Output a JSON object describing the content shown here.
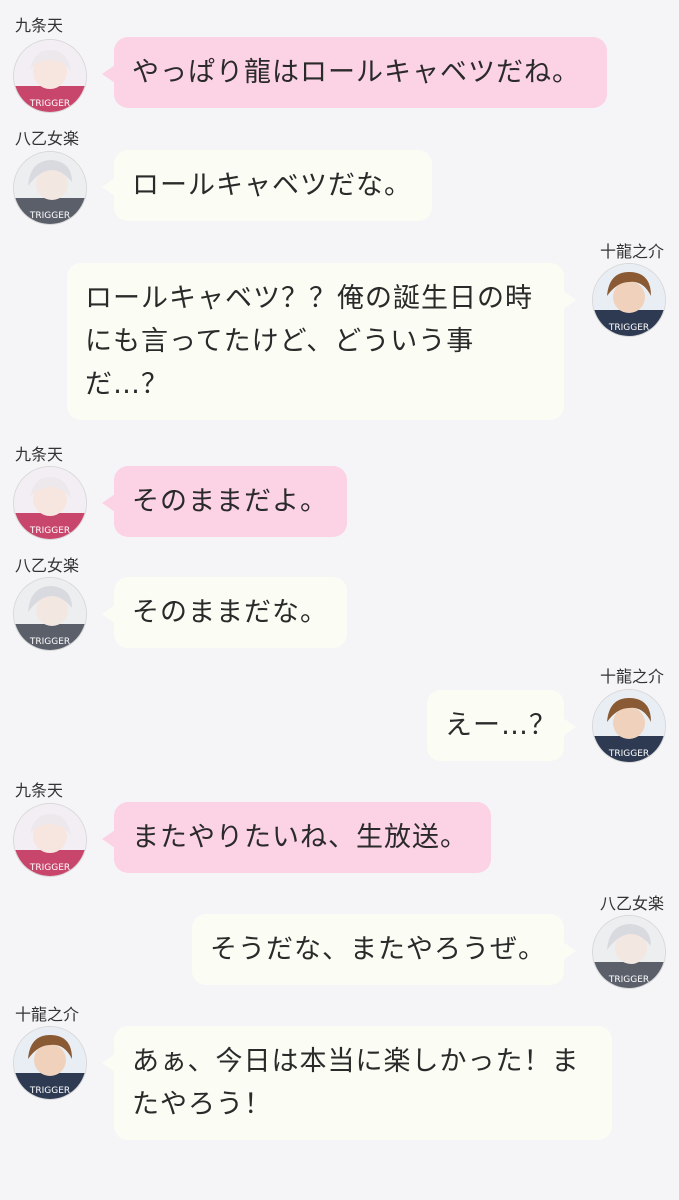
{
  "messages": [
    {
      "sender": "九条天",
      "avatar": "tenn-avatar",
      "side": "left",
      "color": "pink",
      "lines": [
        "やっぱり龍はロールキャベツだね。"
      ]
    },
    {
      "sender": "八乙女楽",
      "avatar": "gaku-avatar",
      "side": "left",
      "color": "white",
      "lines": [
        "ロールキャベツだな。"
      ]
    },
    {
      "sender": "十龍之介",
      "avatar": "ryu-avatar",
      "side": "right",
      "color": "white",
      "lines": [
        "ロールキャベツ？？俺の誕生日の時",
        "にも言ってたけど、どういう事",
        "だ…？"
      ]
    },
    {
      "sender": "九条天",
      "avatar": "tenn-avatar",
      "side": "left",
      "color": "pink",
      "lines": [
        "そのままだよ。"
      ]
    },
    {
      "sender": "八乙女楽",
      "avatar": "gaku-avatar",
      "side": "left",
      "color": "white",
      "lines": [
        "そのままだな。"
      ]
    },
    {
      "sender": "十龍之介",
      "avatar": "ryu-avatar",
      "side": "right",
      "color": "white",
      "lines": [
        "えー…？"
      ]
    },
    {
      "sender": "九条天",
      "avatar": "tenn-avatar",
      "side": "left",
      "color": "pink",
      "lines": [
        "またやりたいね、生放送。"
      ]
    },
    {
      "sender": "八乙女楽",
      "avatar": "gaku-avatar",
      "side": "right",
      "color": "white",
      "lines": [
        "そうだな、またやろうぜ。"
      ]
    },
    {
      "sender": "十龍之介",
      "avatar": "ryu-avatar",
      "side": "left",
      "color": "white",
      "lines": [
        "あぁ、今日は本当に楽しかった！ま",
        "たやろう！"
      ]
    }
  ],
  "avatar_text": "TRIGGER",
  "colors": {
    "pink_bubble": "#fcd2e5",
    "white_bubble": "#fbfdf5",
    "background": "#f5f5f7"
  }
}
